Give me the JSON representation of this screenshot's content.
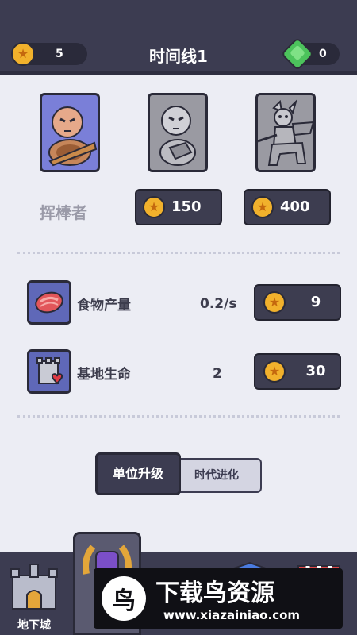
{
  "header": {
    "title": "时间线1",
    "coins": "5",
    "gems": "0"
  },
  "units": {
    "selected_name": "挥棒者",
    "cards": [
      {
        "name": "caveman-club",
        "state": "active"
      },
      {
        "name": "caveman-stone",
        "state": "locked",
        "price": "150"
      },
      {
        "name": "skeleton-rider",
        "state": "locked",
        "price": "400"
      }
    ]
  },
  "stats": [
    {
      "label": "食物产量",
      "value": "0.2/s",
      "cost": "9",
      "icon": "meat-icon"
    },
    {
      "label": "基地生命",
      "value": "2",
      "cost": "30",
      "icon": "castle-heart-icon"
    }
  ],
  "tabs": {
    "unit_upgrade": "单位升级",
    "age_evolution": "时代进化"
  },
  "nav": {
    "items": [
      {
        "label": "地下城",
        "icon": "castle-icon"
      },
      {
        "label": "",
        "icon": "laurel-badge-icon"
      }
    ]
  },
  "watermark": {
    "title": "下载鸟资源",
    "url": "www.xiazainiao.com"
  },
  "colors": {
    "header": "#3c3c51",
    "background": "#ecedf4",
    "coin": "#f1b12c",
    "active_card": "#7a7fd8",
    "gem": "#4cc35c"
  }
}
